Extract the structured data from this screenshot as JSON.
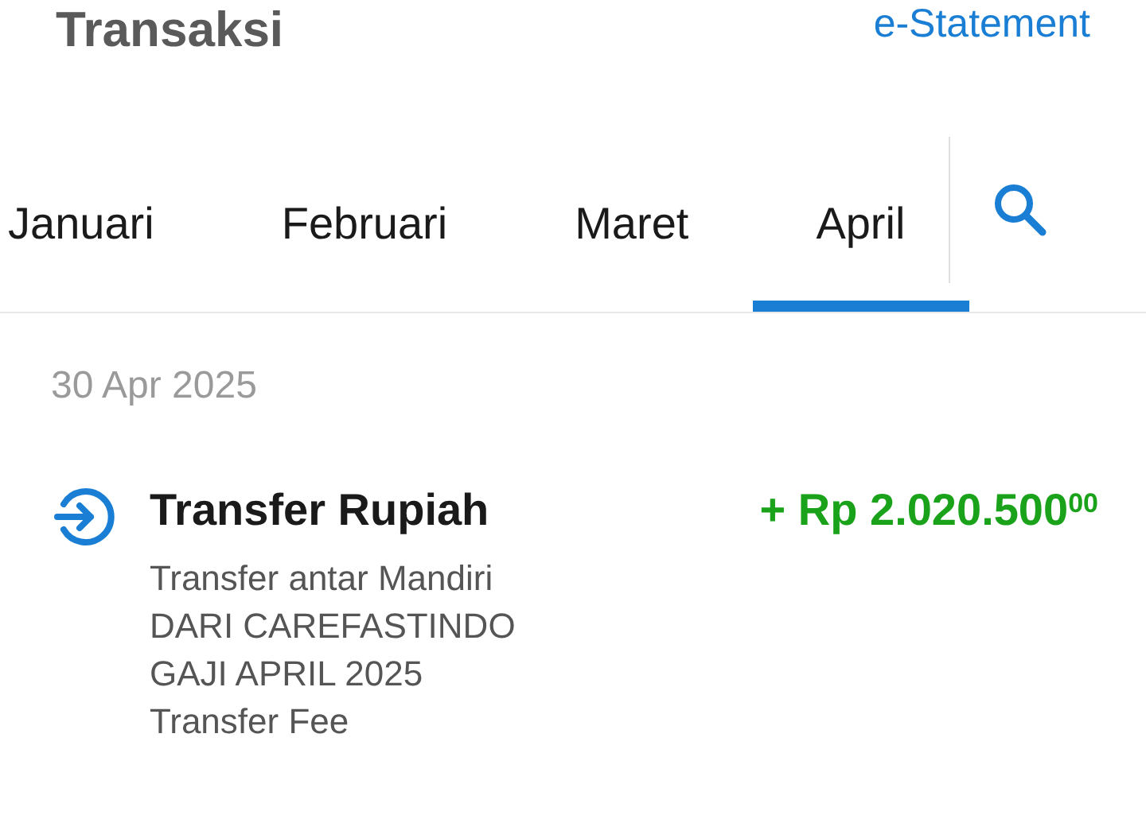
{
  "header": {
    "title": "Transaksi",
    "link": "e-Statement"
  },
  "tabs": [
    {
      "label": "Januari",
      "selected": false
    },
    {
      "label": "Februari",
      "selected": false
    },
    {
      "label": "Maret",
      "selected": false
    },
    {
      "label": "April",
      "selected": true
    }
  ],
  "groups": [
    {
      "date": "30 Apr 2025",
      "transactions": [
        {
          "title": "Transfer Rupiah",
          "amount": "+ Rp 2.020.500$^{00}$",
          "kind": "incoming",
          "details": [
            "Transfer antar Mandiri",
            "DARI CAREFASTINDO",
            "GAJI APRIL 2025",
            "Transfer Fee"
          ]
        }
      ]
    }
  ]
}
